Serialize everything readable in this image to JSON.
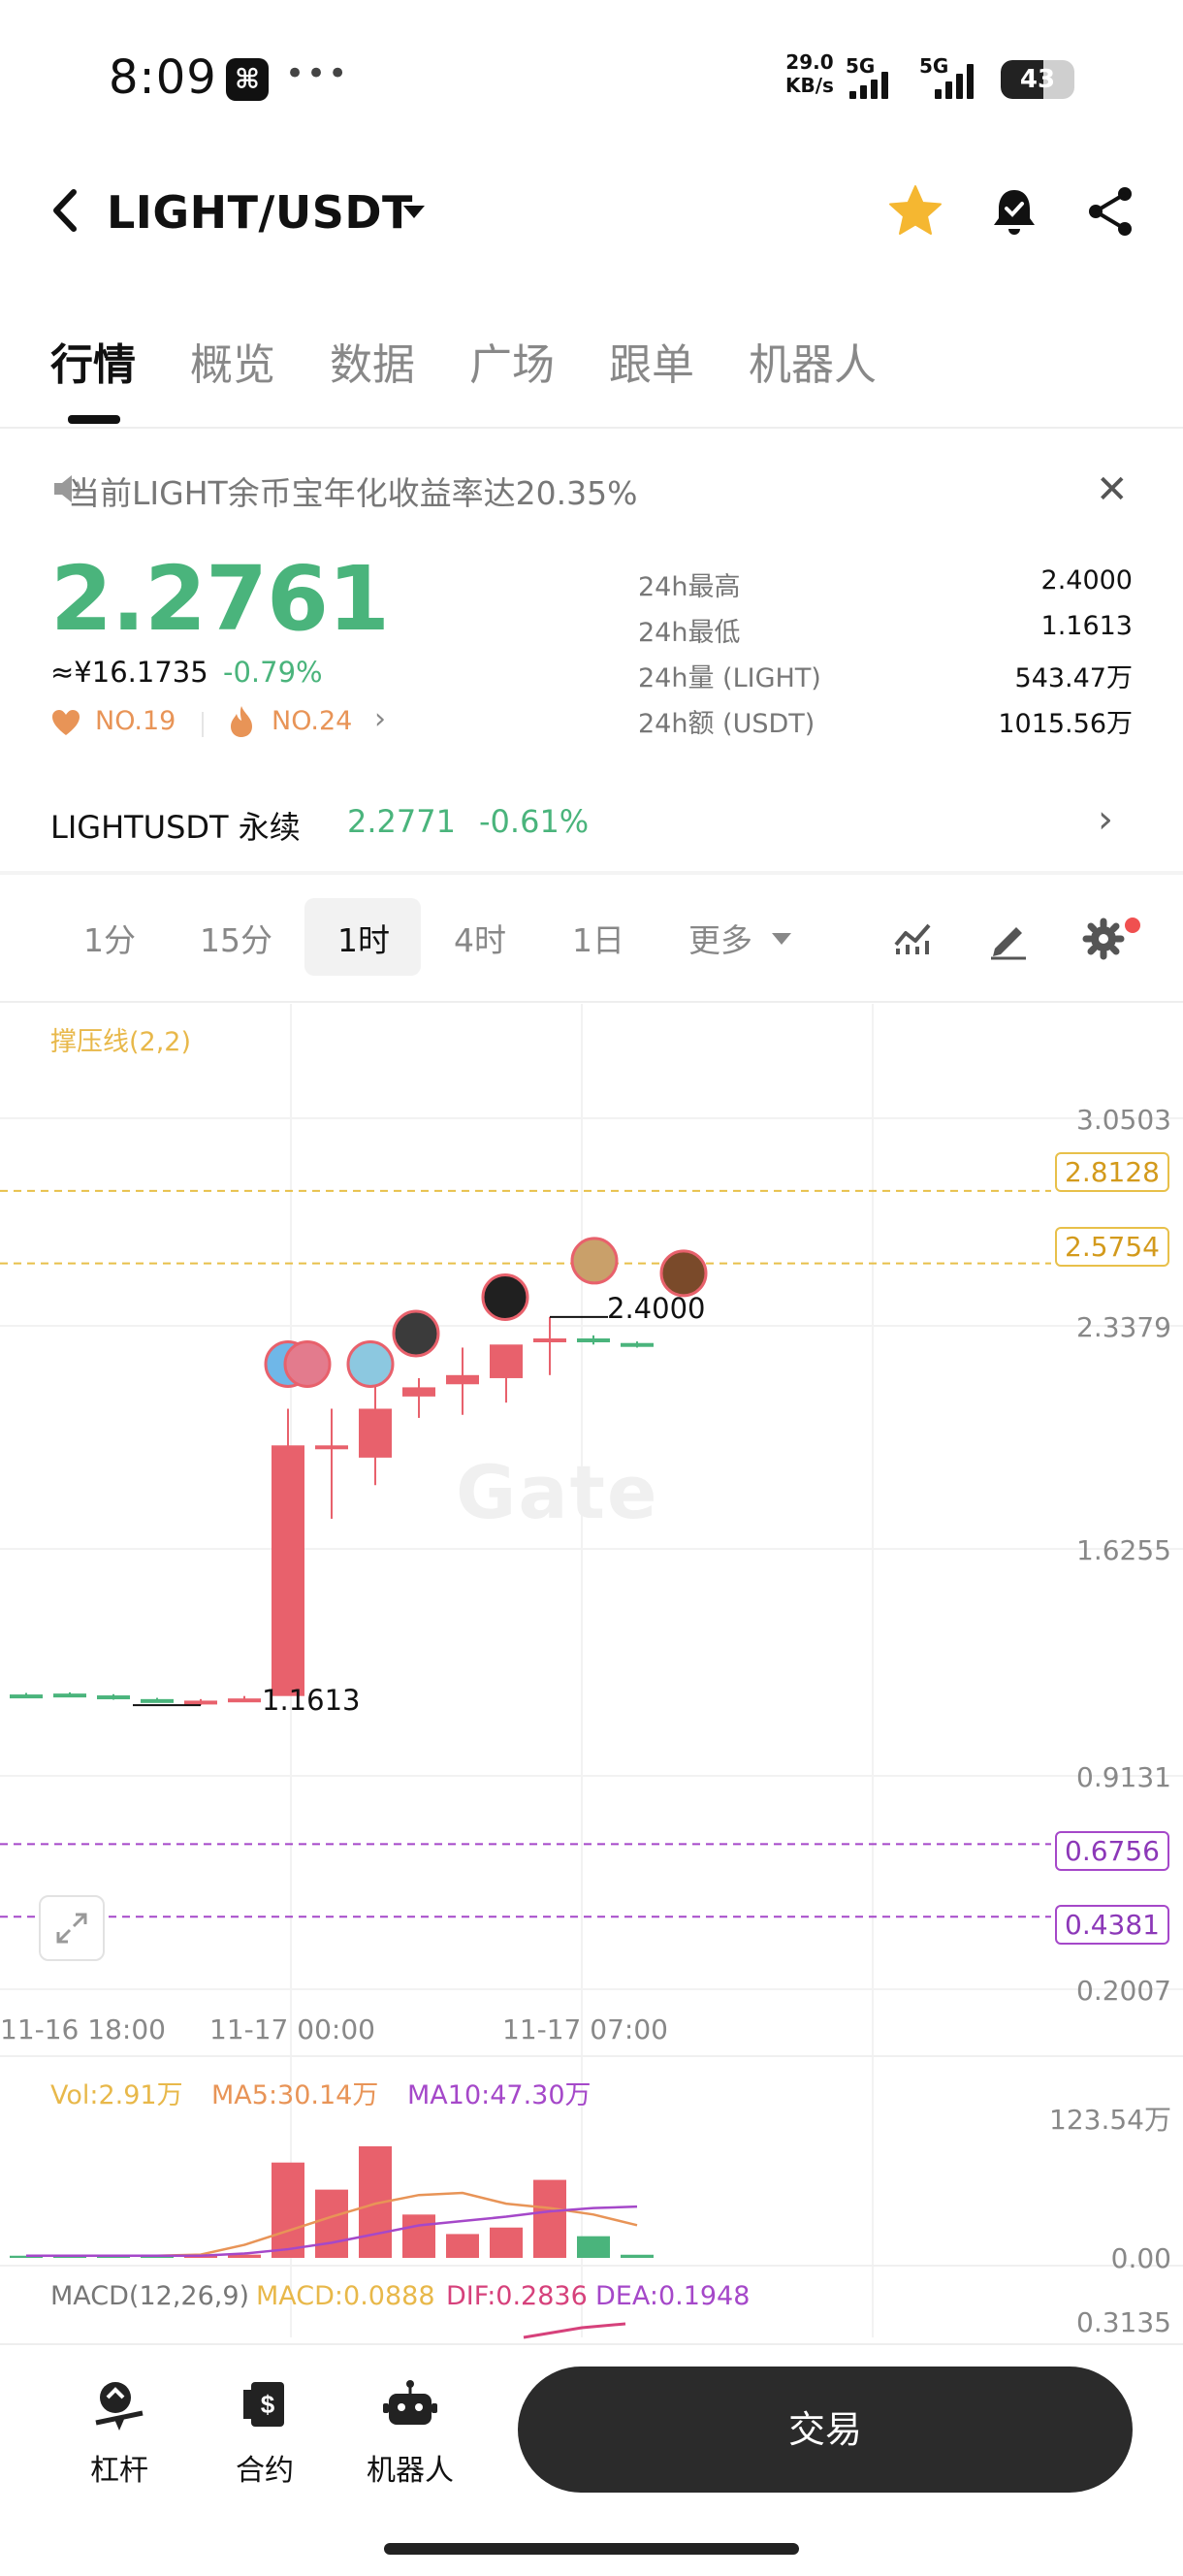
{
  "status_bar": {
    "time": "8:09",
    "app_icon": "capcut-icon",
    "net_speed_value": "29.0",
    "net_speed_unit": "KB/s",
    "signal_1": "5G",
    "signal_2": "5G",
    "battery": "43"
  },
  "header": {
    "pair": "LIGHT/USDT",
    "icons": [
      "back-icon",
      "star-icon",
      "bell-icon",
      "share-icon"
    ]
  },
  "tabs": [
    {
      "label": "行情",
      "active": true
    },
    {
      "label": "概览"
    },
    {
      "label": "数据"
    },
    {
      "label": "广场"
    },
    {
      "label": "跟单"
    },
    {
      "label": "机器人"
    }
  ],
  "notice": {
    "text": "当前LIGHT余币宝年化收益率达20.35%"
  },
  "price": {
    "last": "2.2761",
    "cny": "≈¥16.1735",
    "change": "-0.79%",
    "rank1": "NO.19",
    "rank2": "NO.24"
  },
  "stats": [
    {
      "label": "24h最高",
      "value": "2.4000"
    },
    {
      "label": "24h最低",
      "value": "1.1613"
    },
    {
      "label": "24h量 (LIGHT)",
      "value": "543.47万"
    },
    {
      "label": "24h额 (USDT)",
      "value": "1015.56万"
    }
  ],
  "perpetual": {
    "name": "LIGHTUSDT 永续",
    "price": "2.2771",
    "change": "-0.61%"
  },
  "timeframes": [
    "1分",
    "15分",
    "1时",
    "4时",
    "1日",
    "更多"
  ],
  "timeframe_active": "1时",
  "chart": {
    "indicator_label": "撑压线(2,2)",
    "price_axis": [
      "3.0503",
      "2.3379",
      "1.6255",
      "0.9131",
      "0.2007"
    ],
    "support_resistance": [
      "2.8128",
      "2.5754",
      "0.6756",
      "0.4381"
    ],
    "high_label": "2.4000",
    "low_label": "1.1613",
    "time_axis": [
      "11-16 18:00",
      "11-17 00:00",
      "11-17 07:00"
    ],
    "watermark": "Gate",
    "volume_header": {
      "vol": "Vol:2.91万",
      "ma5": "MA5:30.14万",
      "ma10": "MA10:47.30万"
    },
    "volume_axis": [
      "123.54万",
      "0.00"
    ],
    "macd_header": {
      "name": "MACD(12,26,9)",
      "macd": "MACD:0.0888",
      "dif": "DIF:0.2836",
      "dea": "DEA:0.1948"
    },
    "macd_axis": "0.3135",
    "colors": {
      "up": "#4ab47c",
      "down": "#e8616c",
      "sr_yellow": "#e8c04a",
      "sr_purple": "#a548c9"
    }
  },
  "chart_data": {
    "type": "candlestick",
    "x_labels": [
      "11-16 18:00",
      "11-17 00:00",
      "11-17 07:00"
    ],
    "ylim": [
      0.2007,
      3.0503
    ],
    "candles": [
      {
        "o": 1.165,
        "h": 1.17,
        "l": 1.16,
        "c": 1.163,
        "dir": "up"
      },
      {
        "o": 1.168,
        "h": 1.172,
        "l": 1.16,
        "c": 1.162,
        "dir": "up"
      },
      {
        "o": 1.162,
        "h": 1.166,
        "l": 1.148,
        "c": 1.153,
        "dir": "up"
      },
      {
        "o": 1.15,
        "h": 1.154,
        "l": 1.145,
        "c": 1.148,
        "dir": "up"
      },
      {
        "o": 1.14,
        "h": 1.15,
        "l": 1.13,
        "c": 1.145,
        "dir": "down"
      },
      {
        "o": 1.145,
        "h": 1.16,
        "l": 1.14,
        "c": 1.152,
        "dir": "down"
      },
      {
        "o": 1.16,
        "h": 2.1,
        "l": 1.1613,
        "c": 1.98,
        "dir": "down"
      },
      {
        "o": 1.98,
        "h": 2.1,
        "l": 1.74,
        "c": 1.98,
        "dir": "down"
      },
      {
        "o": 1.94,
        "h": 2.2,
        "l": 1.85,
        "c": 2.1,
        "dir": "down"
      },
      {
        "o": 2.14,
        "h": 2.2,
        "l": 2.07,
        "c": 2.17,
        "dir": "down"
      },
      {
        "o": 2.18,
        "h": 2.3,
        "l": 2.08,
        "c": 2.21,
        "dir": "down"
      },
      {
        "o": 2.2,
        "h": 2.3,
        "l": 2.12,
        "c": 2.31,
        "dir": "down"
      },
      {
        "o": 2.33,
        "h": 2.4,
        "l": 2.21,
        "c": 2.33,
        "dir": "down"
      },
      {
        "o": 2.33,
        "h": 2.34,
        "l": 2.31,
        "c": 2.325,
        "dir": "up"
      },
      {
        "o": 2.315,
        "h": 2.32,
        "l": 2.3,
        "c": 2.31,
        "dir": "up"
      }
    ],
    "volume": [
      2,
      2,
      2,
      2,
      3,
      3,
      88,
      63,
      103,
      40,
      22,
      28,
      72,
      20,
      2.91
    ],
    "volume_ylim": [
      0,
      123.54
    ],
    "ma5": [
      2,
      2,
      2,
      2,
      3,
      12,
      25,
      38,
      50,
      58,
      60,
      50,
      46,
      40,
      30.14
    ],
    "ma10": [
      2,
      2,
      2,
      2,
      2,
      4,
      8,
      14,
      22,
      30,
      34,
      38,
      43,
      46,
      47.3
    ]
  },
  "bottom_nav": [
    {
      "label": "杠杆",
      "icon": "leverage-icon"
    },
    {
      "label": "合约",
      "icon": "contract-icon"
    },
    {
      "label": "机器人",
      "icon": "robot-icon"
    }
  ],
  "trade_button": "交易"
}
